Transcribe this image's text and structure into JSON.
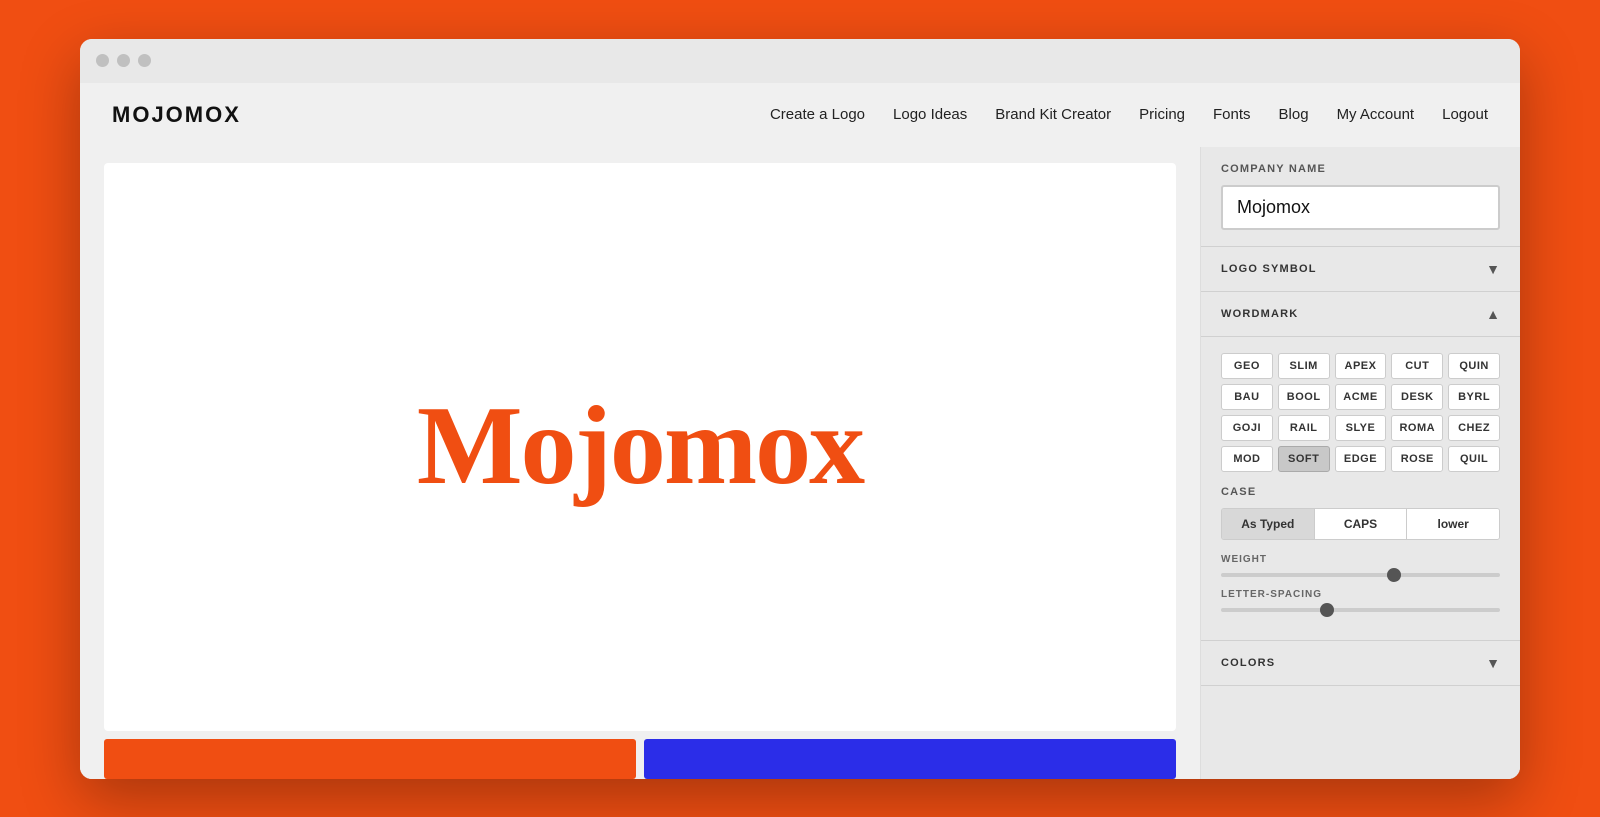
{
  "browser": {
    "dots": [
      "#c0c0c0",
      "#c0c0c0",
      "#c0c0c0"
    ]
  },
  "navbar": {
    "logo": "MOJOMOX",
    "links": [
      {
        "label": "Create a Logo",
        "id": "create-logo"
      },
      {
        "label": "Logo Ideas",
        "id": "logo-ideas"
      },
      {
        "label": "Brand Kit Creator",
        "id": "brand-kit"
      },
      {
        "label": "Pricing",
        "id": "pricing"
      },
      {
        "label": "Fonts",
        "id": "fonts"
      },
      {
        "label": "Blog",
        "id": "blog"
      },
      {
        "label": "My Account",
        "id": "my-account"
      },
      {
        "label": "Logout",
        "id": "logout"
      }
    ]
  },
  "canvas": {
    "logo_text": "Mojomox",
    "color_swatches": [
      {
        "color": "#f04e12"
      },
      {
        "color": "#2b2de8"
      }
    ]
  },
  "panel": {
    "company_name_label": "COMPANY NAME",
    "company_name_value": "Mojomox",
    "company_name_placeholder": "Mojomox",
    "logo_symbol_label": "LOGO SYMBOL",
    "wordmark_label": "WORDMARK",
    "fonts": [
      {
        "label": "GEO",
        "id": "geo",
        "active": false
      },
      {
        "label": "SLIM",
        "id": "slim",
        "active": false
      },
      {
        "label": "APEX",
        "id": "apex",
        "active": false
      },
      {
        "label": "CUT",
        "id": "cut",
        "active": false
      },
      {
        "label": "QUIN",
        "id": "quin",
        "active": false
      },
      {
        "label": "BAU",
        "id": "bau",
        "active": false
      },
      {
        "label": "BOOL",
        "id": "bool",
        "active": false
      },
      {
        "label": "ACME",
        "id": "acme",
        "active": false
      },
      {
        "label": "DESK",
        "id": "desk",
        "active": false
      },
      {
        "label": "BYRL",
        "id": "byrl",
        "active": false
      },
      {
        "label": "GOJI",
        "id": "goji",
        "active": false
      },
      {
        "label": "RAIL",
        "id": "rail",
        "active": false
      },
      {
        "label": "SLYE",
        "id": "slye",
        "active": false
      },
      {
        "label": "ROMA",
        "id": "roma",
        "active": false
      },
      {
        "label": "CHEZ",
        "id": "chez",
        "active": false
      },
      {
        "label": "MOD",
        "id": "mod",
        "active": false
      },
      {
        "label": "SOFT",
        "id": "soft",
        "active": true
      },
      {
        "label": "EDGE",
        "id": "edge",
        "active": false
      },
      {
        "label": "ROSE",
        "id": "rose",
        "active": false
      },
      {
        "label": "QUIL",
        "id": "quil",
        "active": false
      }
    ],
    "case_label": "CASE",
    "case_options": [
      {
        "label": "As Typed",
        "active": true
      },
      {
        "label": "CAPS",
        "active": false
      },
      {
        "label": "lower",
        "active": false
      }
    ],
    "weight_label": "WEIGHT",
    "weight_value": 62,
    "letter_spacing_label": "LETTER-SPACING",
    "letter_spacing_value": 38,
    "colors_label": "COLORS"
  }
}
